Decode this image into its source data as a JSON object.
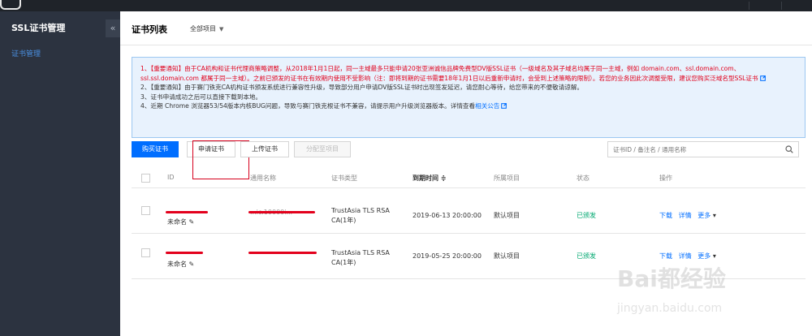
{
  "sidebar": {
    "title": "SSL证书管理",
    "collapse_icon": "«",
    "items": [
      {
        "label": "证书管理"
      }
    ]
  },
  "header": {
    "title": "证书列表",
    "filter_label": "全部项目",
    "filter_caret": "▼"
  },
  "notice": {
    "line1_prefix": "1、【重要通知】由于CA机构和证书代理商策略调整，从2018年1月1日起，同一主域最多只能申请20张亚洲诚信品牌免费型DV版SSL证书（一级域名及其子域名均属于同一主域，例如 domain.com、ssl.domain.com、ssl.ssl.domain.com 都属于同一主域）。之前已颁发的证书在有效期内使用不受影响（注：即将到期的证书需要18年1月1日以后重新申请时，会受到上述策略的限制）。若您的业务因此次调整受限，建议您购买泛域名型SSL证书",
    "line2": "2、【重要通知】由于赛门铁克CA机构证书颁发系统进行兼容性升级，导致部分用户申请DV版SSL证书时出现签发延迟，请您耐心等待，给您带来的不便敬请谅解。",
    "line3": "3、证书申请成功之后可以直接下载到本地。",
    "line4_prefix": "4、近期 Chrome 浏览器53/54版本内核BUG问题，导致与赛门铁克根证书不兼容，请提示用户升级浏览器版本。详情查看",
    "line4_link": "相关公告"
  },
  "toolbar": {
    "buy_label": "购买证书",
    "apply_label": "申请证书",
    "upload_label": "上传证书",
    "assign_label": "分配至项目",
    "search_placeholder": "证书ID / 备注名 / 通用名称"
  },
  "table": {
    "headers": {
      "id": "ID",
      "common_name": "通用名称",
      "type": "证书类型",
      "expire": "到期时间",
      "sort_icon": "≑",
      "project": "所属项目",
      "status": "状态",
      "actions": "操作"
    },
    "rows": [
      {
        "alias": "未命名",
        "common_name": "...ic.10000i...",
        "type_line1": "TrustAsia TLS RSA",
        "type_line2": "CA(1年)",
        "expire": "2019-06-13 20:00:00",
        "project": "默认项目",
        "status": "已颁发",
        "download": "下载",
        "detail": "详情",
        "more": "更多"
      },
      {
        "alias": "未命名",
        "common_name": "",
        "type_line1": "TrustAsia TLS RSA",
        "type_line2": "CA(1年)",
        "expire": "2019-05-25 20:00:00",
        "project": "默认项目",
        "status": "已颁发",
        "download": "下载",
        "detail": "详情",
        "more": "更多"
      }
    ]
  },
  "watermark": {
    "text": "Bai都经验",
    "sub": "jingyan.baidu.com"
  },
  "colors": {
    "accent": "#006eff",
    "alert": "#e1001c",
    "success": "#00a870",
    "sidebar": "#2c3340"
  }
}
